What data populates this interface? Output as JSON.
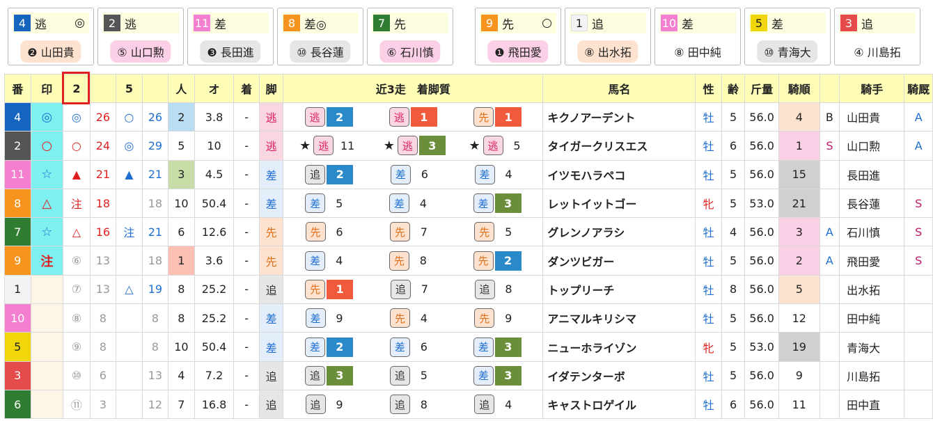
{
  "colors": {
    "frame": {
      "1": "#f3f3f3",
      "2": "#555555",
      "3": "#e54b4b",
      "4": "#1565c0",
      "5": "#f1d60a",
      "6": "#2e7d32",
      "7": "#2e7d32",
      "8": "#f7941d",
      "9": "#f7941d",
      "10": "#f47fd0",
      "11": "#f47fd0"
    },
    "style": {
      "逃": "#f8d7e1",
      "先": "#fde3cf",
      "差": "#e4eefa",
      "追": "#e6e6e6"
    }
  },
  "cards": [
    {
      "num": "4",
      "style": "逃",
      "mark": "◎",
      "jockey": "❷ 山田貴"
    },
    {
      "num": "2",
      "style": "逃",
      "mark": "",
      "jockey": "⑤ 山口勲"
    },
    {
      "num": "11",
      "style": "差",
      "mark": "",
      "jockey": "❸ 長田進"
    },
    {
      "num": "8",
      "style": "差◎",
      "mark": "",
      "jockey": "⑩ 長谷蓮"
    },
    {
      "num": "7",
      "style": "先",
      "mark": "",
      "jockey": "⑥ 石川慎"
    },
    {
      "num": "9",
      "style": "先",
      "mark": "○",
      "jockey": "❶ 飛田愛"
    },
    {
      "num": "1",
      "style": "追",
      "mark": "",
      "jockey": "⑧ 出水拓"
    },
    {
      "num": "10",
      "style": "差",
      "mark": "",
      "jockey": "⑧ 田中純"
    },
    {
      "num": "5",
      "style": "差",
      "mark": "",
      "jockey": "⑩ 青海大"
    },
    {
      "num": "3",
      "style": "追",
      "mark": "",
      "jockey": "④ 川島拓"
    }
  ],
  "headers": {
    "ban": "番",
    "mark": "印",
    "c2": "2",
    "c5": "5",
    "ninki": "人",
    "odds": "オ",
    "chaku": "着",
    "kyaku": "脚",
    "recent": "近3走　着脚質",
    "name": "馬名",
    "sex": "性",
    "age": "齢",
    "weight": "斤量",
    "kijun": "騎順",
    "jockey": "騎手",
    "kikyu": "騎厩"
  },
  "rows": [
    {
      "ban": "4",
      "mark": "◎",
      "m2": "◎",
      "v2": "26",
      "m5": "○",
      "v5": "26",
      "ninki": "2",
      "odds": "3.8",
      "chaku": "-",
      "kyaku": "逃",
      "recent": [
        {
          "star": "",
          "s": "逃",
          "p": "2",
          "pc": "#2a8ac9"
        },
        {
          "star": "",
          "s": "逃",
          "p": "1",
          "pc": "#f15a3a"
        },
        {
          "star": "",
          "s": "先",
          "p": "1",
          "pc": "#f15a3a"
        }
      ],
      "name": "キクノアーデント",
      "sex": "牡",
      "age": "5",
      "weight": "56.0",
      "kijun": "4",
      "k1": "B",
      "jockey": "山田貴",
      "kikyu": "A"
    },
    {
      "ban": "2",
      "mark": "○",
      "m2": "○",
      "v2": "24",
      "m5": "◎",
      "v5": "29",
      "ninki": "5",
      "odds": "10",
      "chaku": "-",
      "kyaku": "逃",
      "recent": [
        {
          "star": "★",
          "s": "逃",
          "p": "11",
          "pc": ""
        },
        {
          "star": "★",
          "s": "逃",
          "p": "3",
          "pc": "#6b8e3a"
        },
        {
          "star": "★",
          "s": "逃",
          "p": "5",
          "pc": ""
        }
      ],
      "name": "タイガークリスエス",
      "sex": "牡",
      "age": "6",
      "weight": "56.0",
      "kijun": "1",
      "k1": "S",
      "jockey": "山口勲",
      "kikyu": "A"
    },
    {
      "ban": "11",
      "mark": "☆",
      "m2": "▲",
      "v2": "21",
      "m5": "▲",
      "v5": "21",
      "ninki": "3",
      "odds": "4.5",
      "chaku": "-",
      "kyaku": "差",
      "recent": [
        {
          "star": "",
          "s": "追",
          "p": "2",
          "pc": "#2a8ac9"
        },
        {
          "star": "",
          "s": "差",
          "p": "6",
          "pc": ""
        },
        {
          "star": "",
          "s": "差",
          "p": "4",
          "pc": ""
        }
      ],
      "name": "イツモハラペコ",
      "sex": "牡",
      "age": "5",
      "weight": "56.0",
      "kijun": "15",
      "k1": "",
      "jockey": "長田進",
      "kikyu": ""
    },
    {
      "ban": "8",
      "mark": "△",
      "m2": "注",
      "v2": "18",
      "m5": "",
      "v5": "18",
      "ninki": "10",
      "odds": "50.4",
      "chaku": "-",
      "kyaku": "差",
      "recent": [
        {
          "star": "",
          "s": "差",
          "p": "5",
          "pc": ""
        },
        {
          "star": "",
          "s": "差",
          "p": "4",
          "pc": ""
        },
        {
          "star": "",
          "s": "差",
          "p": "3",
          "pc": "#6b8e3a"
        }
      ],
      "name": "レットイットゴー",
      "sex": "牝",
      "age": "5",
      "weight": "53.0",
      "kijun": "21",
      "k1": "",
      "jockey": "長谷蓮",
      "kikyu": "S"
    },
    {
      "ban": "7",
      "mark": "☆",
      "m2": "△",
      "v2": "16",
      "m5": "注",
      "v5": "21",
      "ninki": "6",
      "odds": "12.6",
      "chaku": "-",
      "kyaku": "先",
      "recent": [
        {
          "star": "",
          "s": "先",
          "p": "6",
          "pc": ""
        },
        {
          "star": "",
          "s": "先",
          "p": "7",
          "pc": ""
        },
        {
          "star": "",
          "s": "先",
          "p": "5",
          "pc": ""
        }
      ],
      "name": "グレンノアラシ",
      "sex": "牡",
      "age": "4",
      "weight": "56.0",
      "kijun": "3",
      "k1": "A",
      "jockey": "石川慎",
      "kikyu": "S"
    },
    {
      "ban": "9",
      "mark": "注",
      "m2": "⑥",
      "v2": "13",
      "m5": "",
      "v5": "18",
      "ninki": "1",
      "odds": "3.6",
      "chaku": "-",
      "kyaku": "先",
      "recent": [
        {
          "star": "",
          "s": "差",
          "p": "4",
          "pc": ""
        },
        {
          "star": "",
          "s": "先",
          "p": "8",
          "pc": ""
        },
        {
          "star": "",
          "s": "先",
          "p": "2",
          "pc": "#2a8ac9"
        }
      ],
      "name": "ダンツビガー",
      "sex": "牡",
      "age": "5",
      "weight": "56.0",
      "kijun": "2",
      "k1": "A",
      "jockey": "飛田愛",
      "kikyu": "S"
    },
    {
      "ban": "1",
      "mark": "",
      "m2": "⑦",
      "v2": "13",
      "m5": "△",
      "v5": "19",
      "ninki": "8",
      "odds": "25.2",
      "chaku": "-",
      "kyaku": "追",
      "recent": [
        {
          "star": "",
          "s": "先",
          "p": "1",
          "pc": "#f15a3a"
        },
        {
          "star": "",
          "s": "追",
          "p": "7",
          "pc": ""
        },
        {
          "star": "",
          "s": "追",
          "p": "8",
          "pc": ""
        }
      ],
      "name": "トップリーチ",
      "sex": "牡",
      "age": "8",
      "weight": "56.0",
      "kijun": "5",
      "k1": "",
      "jockey": "出水拓",
      "kikyu": ""
    },
    {
      "ban": "10",
      "mark": "",
      "m2": "⑧",
      "v2": "8",
      "m5": "",
      "v5": "8",
      "ninki": "8",
      "odds": "25.2",
      "chaku": "-",
      "kyaku": "差",
      "recent": [
        {
          "star": "",
          "s": "差",
          "p": "9",
          "pc": ""
        },
        {
          "star": "",
          "s": "先",
          "p": "4",
          "pc": ""
        },
        {
          "star": "",
          "s": "先",
          "p": "9",
          "pc": ""
        }
      ],
      "name": "アニマルキリシマ",
      "sex": "牡",
      "age": "5",
      "weight": "56.0",
      "kijun": "12",
      "k1": "",
      "jockey": "田中純",
      "kikyu": ""
    },
    {
      "ban": "5",
      "mark": "",
      "m2": "⑨",
      "v2": "8",
      "m5": "",
      "v5": "8",
      "ninki": "10",
      "odds": "50.4",
      "chaku": "-",
      "kyaku": "差",
      "recent": [
        {
          "star": "",
          "s": "差",
          "p": "2",
          "pc": "#2a8ac9"
        },
        {
          "star": "",
          "s": "差",
          "p": "6",
          "pc": ""
        },
        {
          "star": "",
          "s": "差",
          "p": "3",
          "pc": "#6b8e3a"
        }
      ],
      "name": "ニューホライゾン",
      "sex": "牝",
      "age": "5",
      "weight": "53.0",
      "kijun": "19",
      "k1": "",
      "jockey": "青海大",
      "kikyu": ""
    },
    {
      "ban": "3",
      "mark": "",
      "m2": "⑩",
      "v2": "6",
      "m5": "",
      "v5": "13",
      "ninki": "4",
      "odds": "7.2",
      "chaku": "-",
      "kyaku": "追",
      "recent": [
        {
          "star": "",
          "s": "追",
          "p": "3",
          "pc": "#6b8e3a"
        },
        {
          "star": "",
          "s": "追",
          "p": "5",
          "pc": ""
        },
        {
          "star": "",
          "s": "差",
          "p": "3",
          "pc": "#6b8e3a"
        }
      ],
      "name": "イダテンターボ",
      "sex": "牡",
      "age": "5",
      "weight": "56.0",
      "kijun": "9",
      "k1": "",
      "jockey": "川島拓",
      "kikyu": ""
    },
    {
      "ban": "6",
      "mark": "",
      "m2": "⑪",
      "v2": "3",
      "m5": "",
      "v5": "12",
      "ninki": "7",
      "odds": "16.8",
      "chaku": "-",
      "kyaku": "追",
      "recent": [
        {
          "star": "",
          "s": "追",
          "p": "9",
          "pc": ""
        },
        {
          "star": "",
          "s": "追",
          "p": "8",
          "pc": ""
        },
        {
          "star": "",
          "s": "追",
          "p": "4",
          "pc": ""
        }
      ],
      "name": "キャストロゲイル",
      "sex": "牡",
      "age": "6",
      "weight": "56.0",
      "kijun": "11",
      "k1": "",
      "jockey": "田中直",
      "kikyu": ""
    }
  ]
}
